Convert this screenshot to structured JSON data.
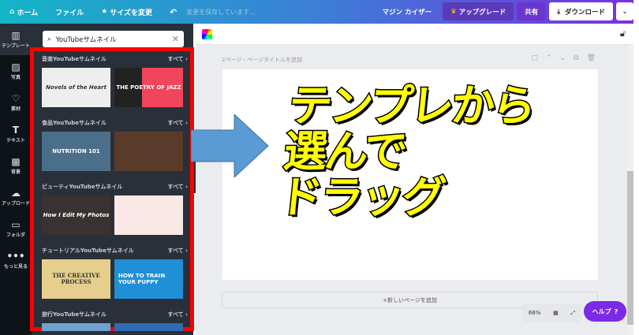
{
  "topbar": {
    "home": "ホーム",
    "file": "ファイル",
    "resize": "サイズを変更",
    "saving": "変更を保存しています...",
    "user": "マジン カイザー",
    "upgrade": "アップグレード",
    "share": "共有",
    "download": "ダウンロード"
  },
  "rail": [
    {
      "label": "テンプレート",
      "icon": "▥"
    },
    {
      "label": "写真",
      "icon": "▨"
    },
    {
      "label": "素材",
      "icon": "♡"
    },
    {
      "label": "テキスト",
      "icon": "T"
    },
    {
      "label": "背景",
      "icon": "▩"
    },
    {
      "label": "アップロード",
      "icon": "☁"
    },
    {
      "label": "フォルダ",
      "icon": "▭"
    },
    {
      "label": "もっと見る",
      "icon": "•••"
    }
  ],
  "search": {
    "value": "YouTubeサムネイル"
  },
  "sections": [
    {
      "title": "音楽YouTubeサムネイル",
      "all": "すべて",
      "t1": "Novels of the Heart",
      "t2": "THE POETRY OF JAZZ"
    },
    {
      "title": "食品YouTubeサムネイル",
      "all": "すべて",
      "t1": "NUTRITION 101",
      "t2": ""
    },
    {
      "title": "ビューティYouTubeサムネイル",
      "all": "すべて",
      "t1": "How I Edit My Photos",
      "t2": ""
    },
    {
      "title": "チュートリアルYouTubeサムネイル",
      "all": "すべて",
      "t1": "THE CREATIVE PROCESS",
      "t2": "HOW TO TRAIN YOUR PUPPY"
    },
    {
      "title": "旅行YouTubeサムネイル",
      "all": "すべて",
      "t1": "",
      "t2": ""
    }
  ],
  "canvas": {
    "page_title": "2ページ - ページタイトルを追加",
    "add_page": "+新しいページを追加",
    "zoom": "66%",
    "help": "ヘルプ",
    "help_icon": "?"
  },
  "overlay": {
    "line1": "テンプレから",
    "line2": "選んで",
    "line3": "ドラッグ"
  }
}
